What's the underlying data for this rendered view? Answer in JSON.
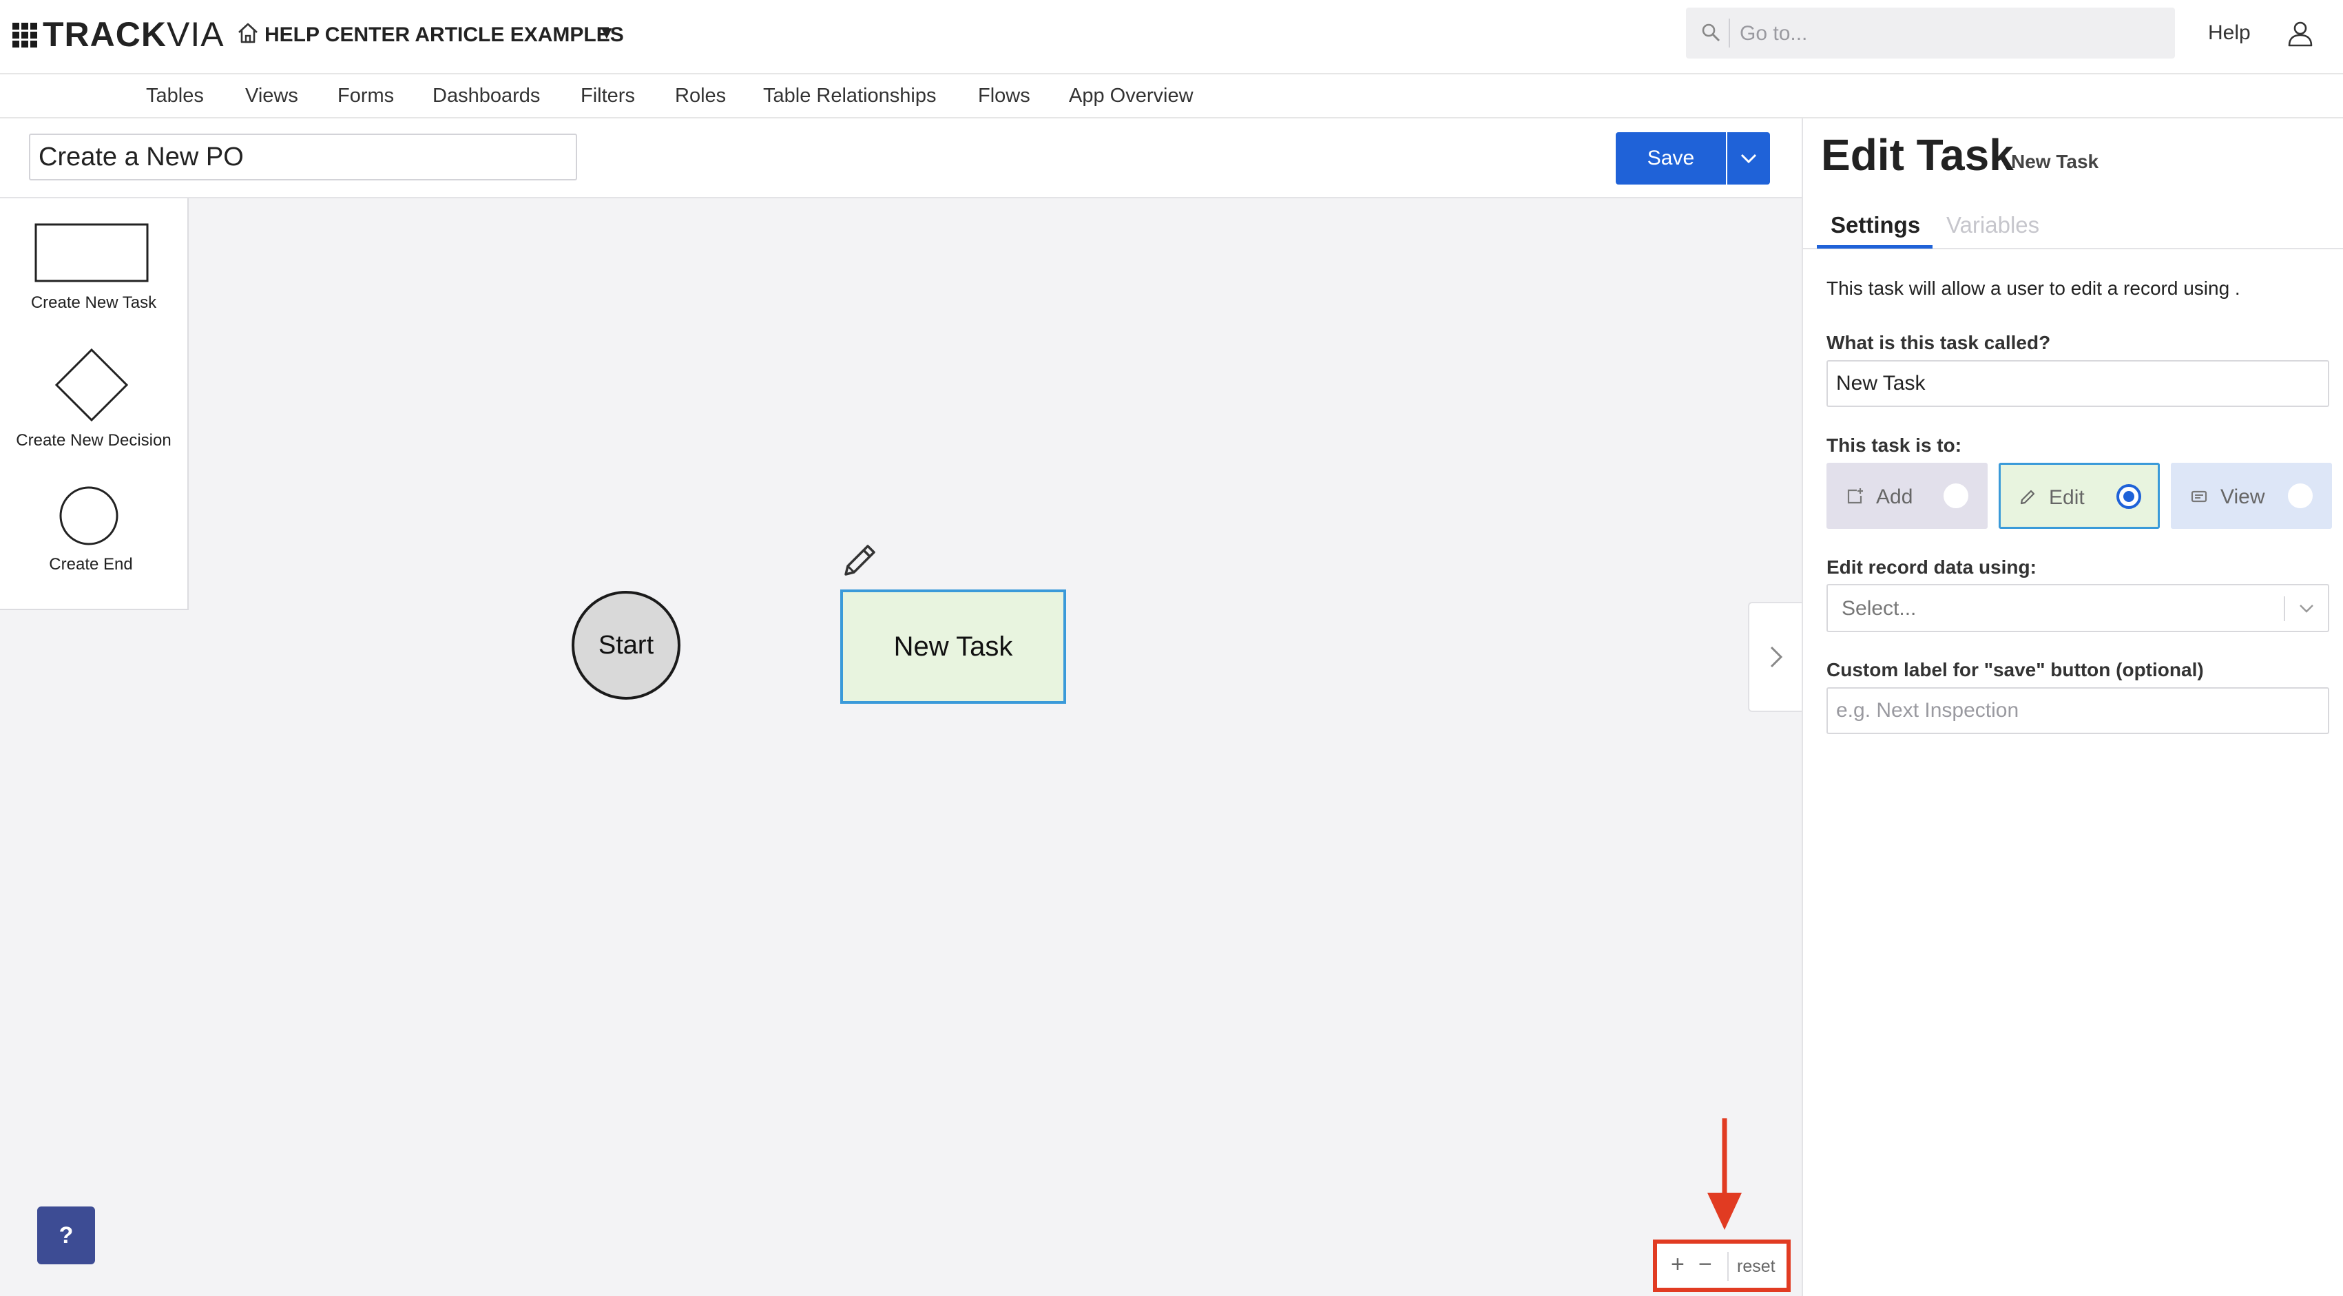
{
  "header": {
    "logo_text": "TRACK",
    "logo_text_suffix": "VIA",
    "app_name": "HELP CENTER ARTICLE EXAMPLES",
    "app_caret": "▼",
    "search_placeholder": "Go to...",
    "help_label": "Help"
  },
  "nav": {
    "items": [
      "Tables",
      "Views",
      "Forms",
      "Dashboards",
      "Filters",
      "Roles",
      "Table Relationships",
      "Flows",
      "App Overview"
    ]
  },
  "toolbar": {
    "flow_name": "Create a New PO",
    "save_label": "Save"
  },
  "palette": {
    "task_label": "Create New Task",
    "decision_label": "Create New Decision",
    "end_label": "Create End"
  },
  "canvas": {
    "start_label": "Start",
    "task_label": "New Task",
    "help_button": "?",
    "zoom_in": "+",
    "zoom_out": "−",
    "zoom_reset": "reset"
  },
  "panel": {
    "title": "Edit Task",
    "subtitle": "New Task",
    "tabs": [
      "Settings",
      "Variables"
    ],
    "description": "This task will allow a user to edit a record using .",
    "name_label": "What is this task called?",
    "name_value": "New Task",
    "task_type_label": "This task is to:",
    "options": [
      {
        "label": "Add",
        "selected": false
      },
      {
        "label": "Edit",
        "selected": true
      },
      {
        "label": "View",
        "selected": false
      }
    ],
    "form_label": "Edit record data using:",
    "form_select_placeholder": "Select...",
    "save_label_label": "Custom label for \"save\" button (optional)",
    "save_label_placeholder": "e.g. Next Inspection"
  },
  "colors": {
    "accent": "#1f62d8",
    "task_fill": "#e8f4df",
    "task_border": "#3a9ad9",
    "highlight": "#e13b22"
  }
}
